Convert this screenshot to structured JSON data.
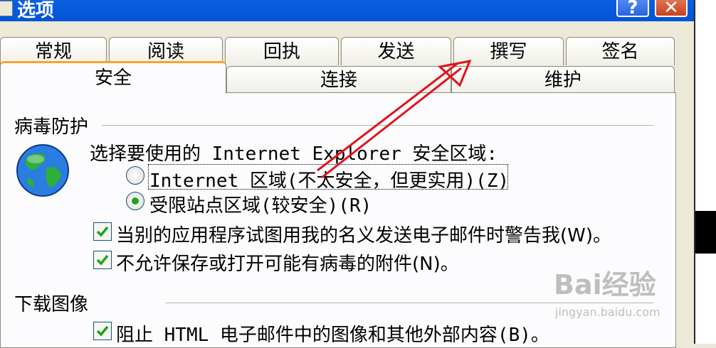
{
  "window": {
    "title": "选项",
    "help_label": "?",
    "close_label": "✕"
  },
  "tabs_back": [
    "常规",
    "阅读",
    "回执",
    "发送",
    "撰写",
    "签名"
  ],
  "tabs_front": [
    "安全",
    "连接",
    "维护"
  ],
  "virus": {
    "heading": "病毒防护",
    "zone_prompt": "选择要使用的 Internet Explorer 安全区域:",
    "radio_internet": "Internet 区域(不太安全，但更实用)(Z)",
    "radio_restricted": "受限站点区域(较安全)(R)",
    "selected_zone": "restricted",
    "check_warn": "当别的应用程序试图用我的名义发送电子邮件时警告我(W)。",
    "check_attach": "不允许保存或打开可能有病毒的附件(N)。"
  },
  "download": {
    "heading": "下载图像",
    "check_block": "阻止 HTML 电子邮件中的图像和其他外部内容(B)。"
  },
  "checkbox_states": {
    "warn": true,
    "attach": true,
    "block": true
  },
  "icons": {
    "globe": "globe-icon",
    "arrow": "red-arrow-annotation"
  },
  "watermark": {
    "brand": "Bai经验",
    "url": "jingyan.baidu.com"
  },
  "colors": {
    "titlebar": "#0453D8",
    "active_tab_accent": "#F4A62C",
    "check_mark": "#21A121",
    "arrow": "#E0141E"
  }
}
